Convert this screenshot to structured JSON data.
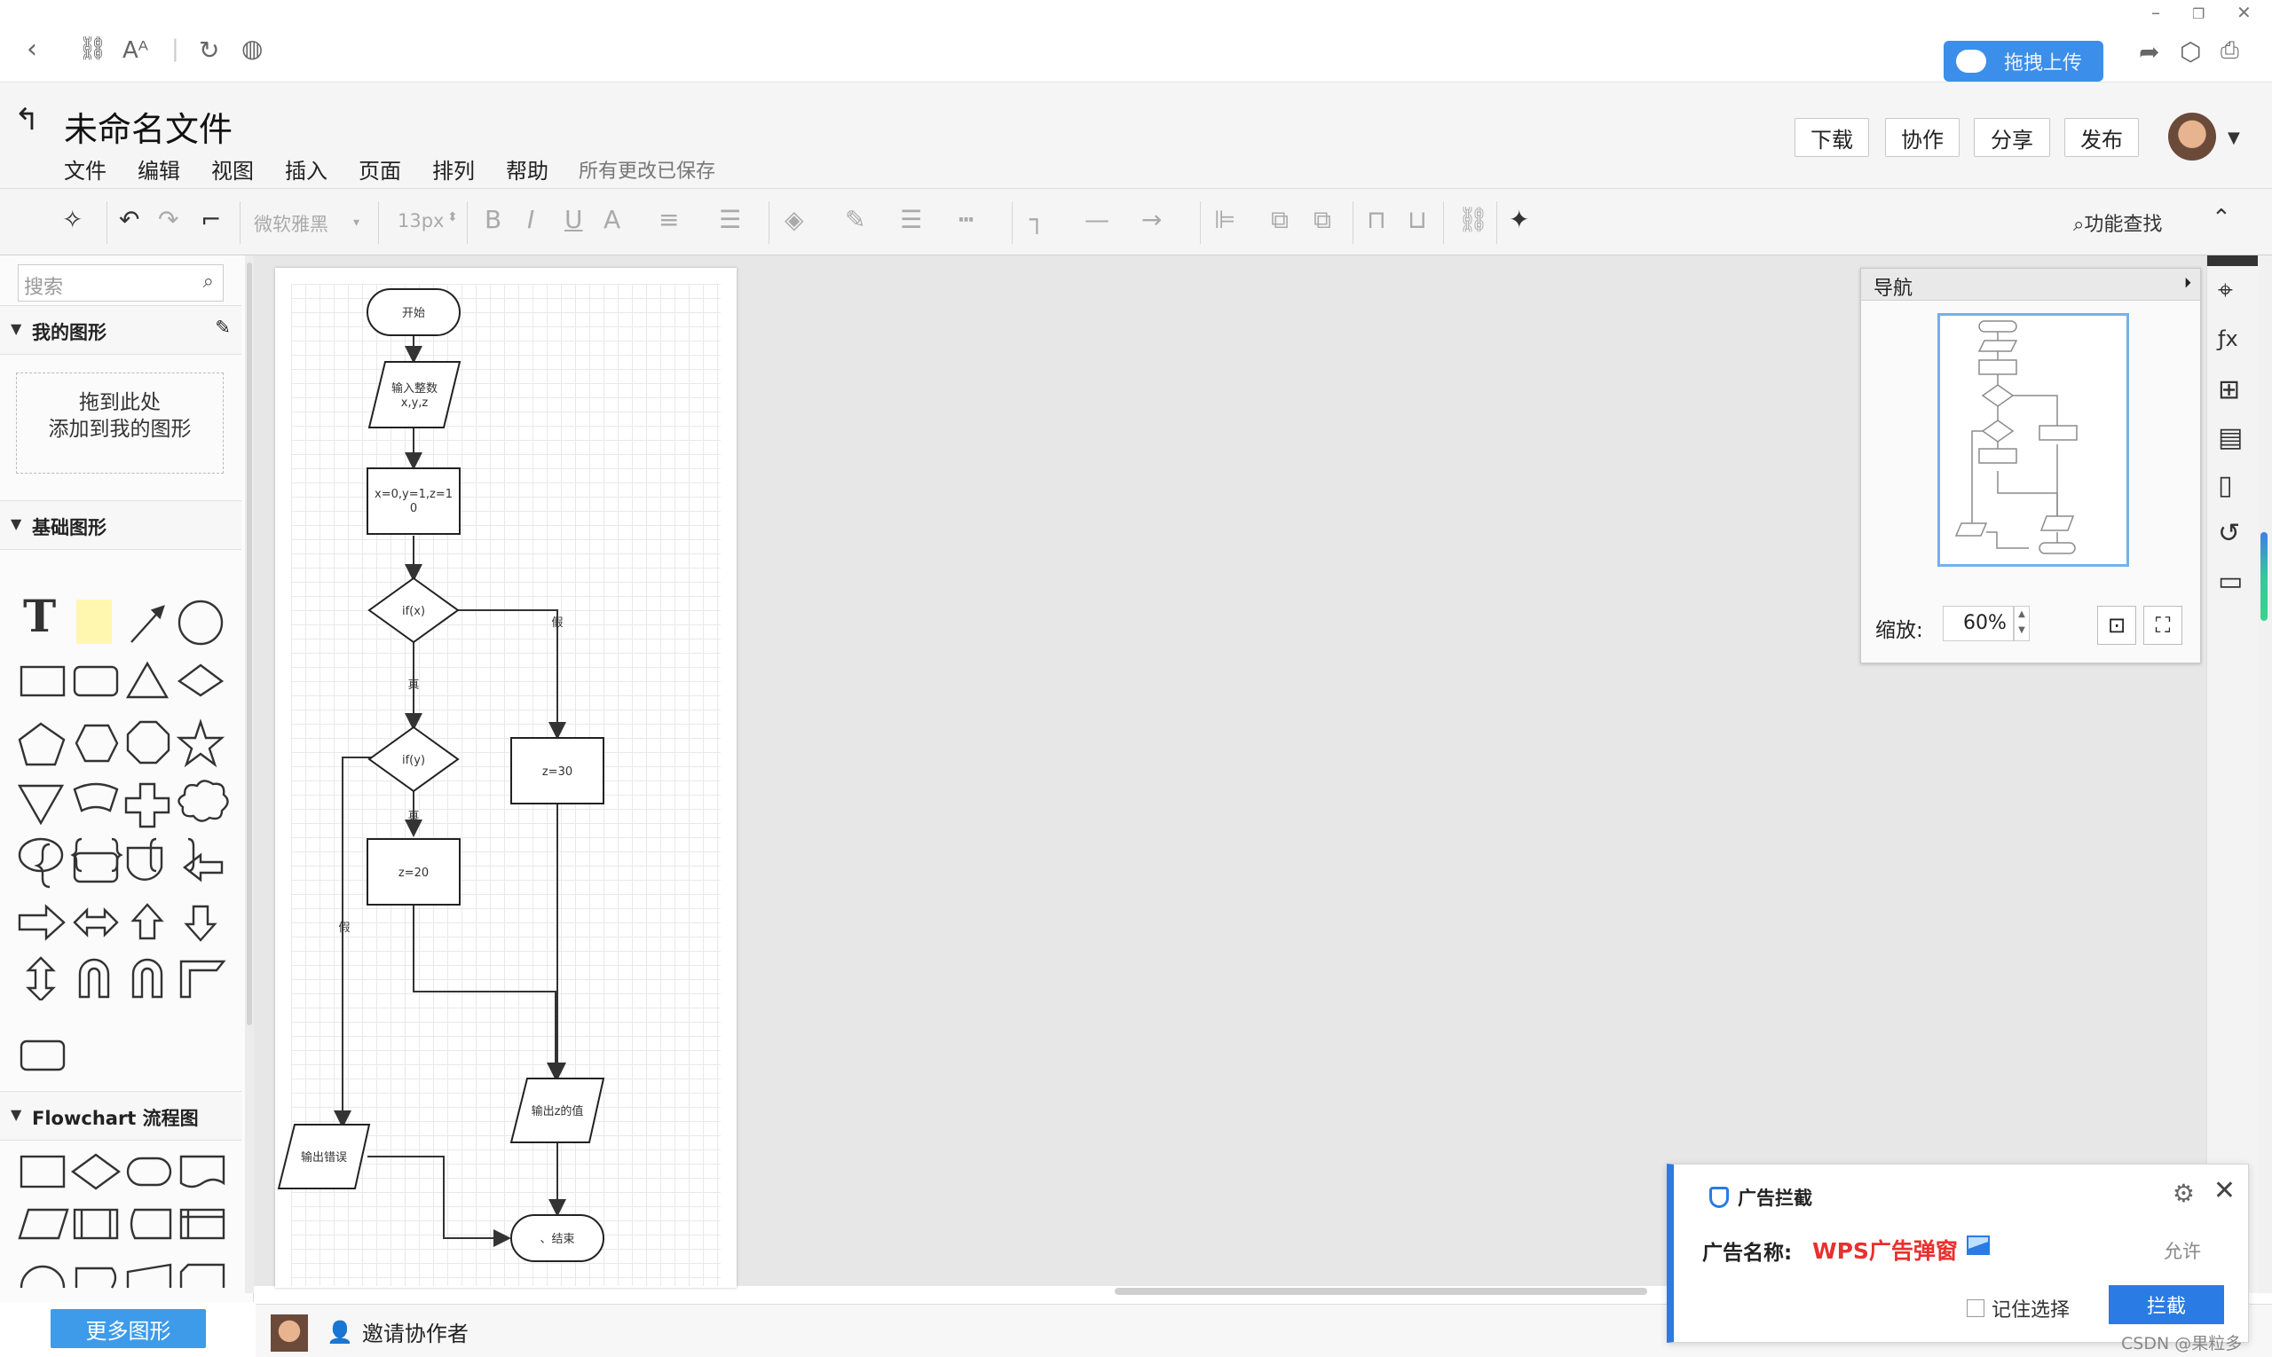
{
  "browser": {
    "upload_button": "拖拽上传"
  },
  "header": {
    "title": "未命名文件",
    "menu": [
      "文件",
      "编辑",
      "视图",
      "插入",
      "页面",
      "排列",
      "帮助"
    ],
    "saved_status": "所有更改已保存",
    "buttons": {
      "download": "下载",
      "collaborate": "协作",
      "share": "分享",
      "publish": "发布"
    }
  },
  "toolbar": {
    "font_family": "微软雅黑",
    "font_size": "13px",
    "function_search": "功能查找"
  },
  "sidebar": {
    "search_placeholder": "搜索",
    "my_shapes": "我的图形",
    "drop_zone_line1": "拖到此处",
    "drop_zone_line2": "添加到我的图形",
    "basic_shapes": "基础图形",
    "flowchart": "Flowchart 流程图",
    "more_shapes": "更多图形"
  },
  "flowchart": {
    "start": "开始",
    "input_line1": "输入整数",
    "input_line2": "x,y,z",
    "assign_line1": "x=0,y=1,z=1",
    "assign_line2": "0",
    "if_x": "if(x)",
    "if_y": "if(y)",
    "z30": "z=30",
    "z20": "z=20",
    "output_z": "输出z的值",
    "output_error": "输出错误",
    "end": "、结束",
    "true_label": "真",
    "false_label": "假"
  },
  "navigator": {
    "title": "导航",
    "zoom_label": "缩放:",
    "zoom_value": "60%"
  },
  "bottom": {
    "invite": "邀请协作者"
  },
  "adblock": {
    "title": "广告拦截",
    "name_label": "广告名称:",
    "name_value": "WPS广告弹窗",
    "allow": "允许",
    "remember": "记住选择",
    "block_button": "拦截"
  },
  "watermark": "CSDN @果粒多"
}
